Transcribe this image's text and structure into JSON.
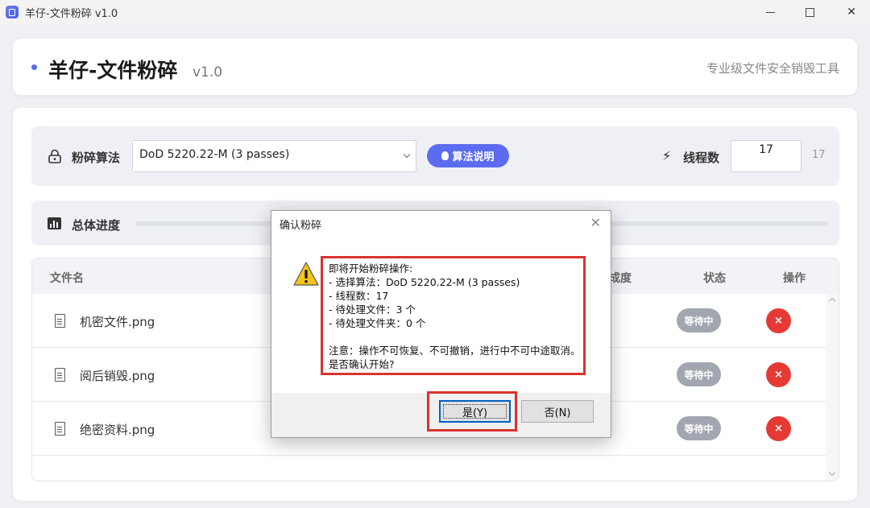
{
  "window": {
    "title": "羊仔-文件粉碎 v1.0",
    "icon": "app-icon",
    "controls": {
      "minimize": "minimize-icon",
      "maximize": "maximize-icon",
      "close": "✕"
    }
  },
  "header": {
    "title": "羊仔-文件粉碎",
    "version": "v1.0",
    "subtitle": "专业级文件安全销毁工具",
    "accent_color": "#5a6ce8"
  },
  "settings": {
    "algorithm_label": "粉碎算法",
    "algorithm_value": "DoD 5220.22-M (3 passes)",
    "algorithm_help": "算法说明",
    "thread_label": "线程数",
    "thread_value": "17",
    "thread_max": "17"
  },
  "progress": {
    "label": "总体进度",
    "value_percent": 0
  },
  "table": {
    "columns": {
      "name": "文件名",
      "progress": "成度",
      "status": "状态",
      "action": "操作"
    },
    "rows": [
      {
        "name": "机密文件.png",
        "status": "等待中",
        "action": "×"
      },
      {
        "name": "阅后销毁.png",
        "status": "等待中",
        "action": "×"
      },
      {
        "name": "绝密资料.png",
        "status": "等待中",
        "action": "×"
      }
    ]
  },
  "dialog": {
    "title": "确认粉碎",
    "close": "✕",
    "lines": [
      "即将开始粉碎操作:",
      "- 选择算法：DoD 5220.22-M (3 passes)",
      "- 线程数：17",
      "- 待处理文件：3 个",
      "- 待处理文件夹：0 个",
      "",
      "注意：操作不可恢复、不可撤销，进行中不可中途取消。",
      "是否确认开始?"
    ],
    "yes_label": "是(Y)",
    "no_label": "否(N)",
    "highlight_color": "#d9332e"
  }
}
